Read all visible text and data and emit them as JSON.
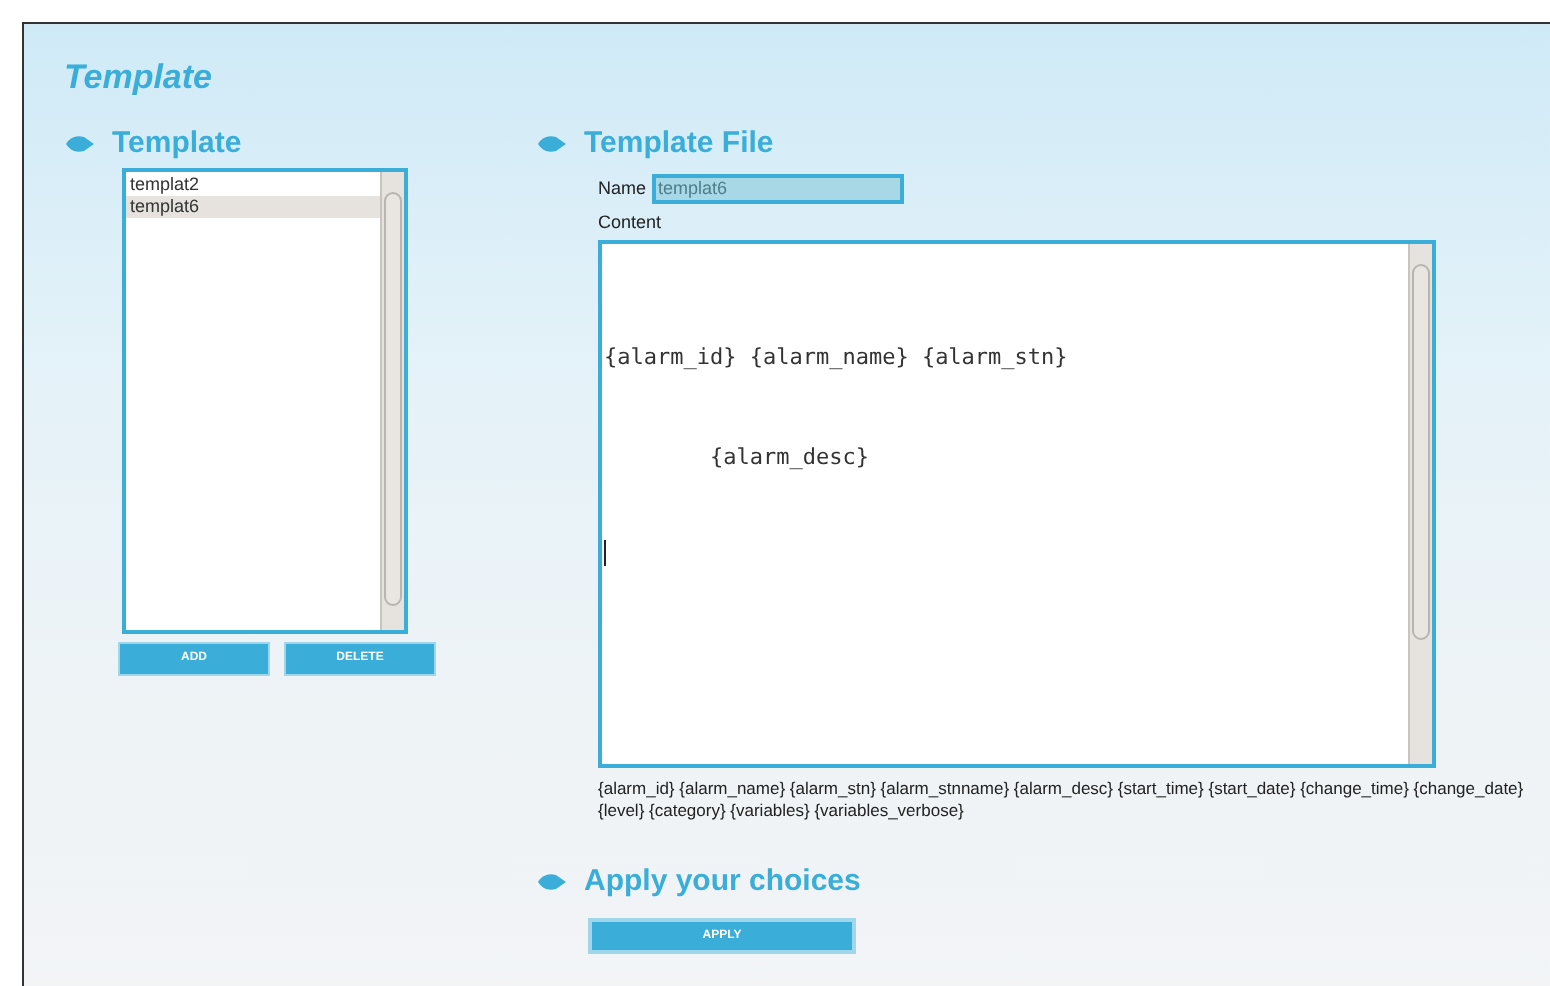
{
  "page_title": "Template",
  "template_list": {
    "heading": "Template",
    "items": [
      {
        "label": "templat2",
        "selected": false
      },
      {
        "label": "templat6",
        "selected": true
      }
    ],
    "buttons": [
      "ADD",
      "DELETE"
    ]
  },
  "template_file": {
    "heading": "Template File",
    "name_label": "Name",
    "name_value": "templat6",
    "content_label": "Content",
    "content_lines": [
      "{alarm_id} {alarm_name} {alarm_stn}",
      "        {alarm_desc}"
    ],
    "variables": "{alarm_id} {alarm_name} {alarm_stn} {alarm_stnname} {alarm_desc} {start_time} {start_date} {change_time} {change_date} {level} {category} {variables} {variables_verbose}"
  },
  "apply": {
    "heading": "Apply your choices",
    "button": "APPLY"
  }
}
